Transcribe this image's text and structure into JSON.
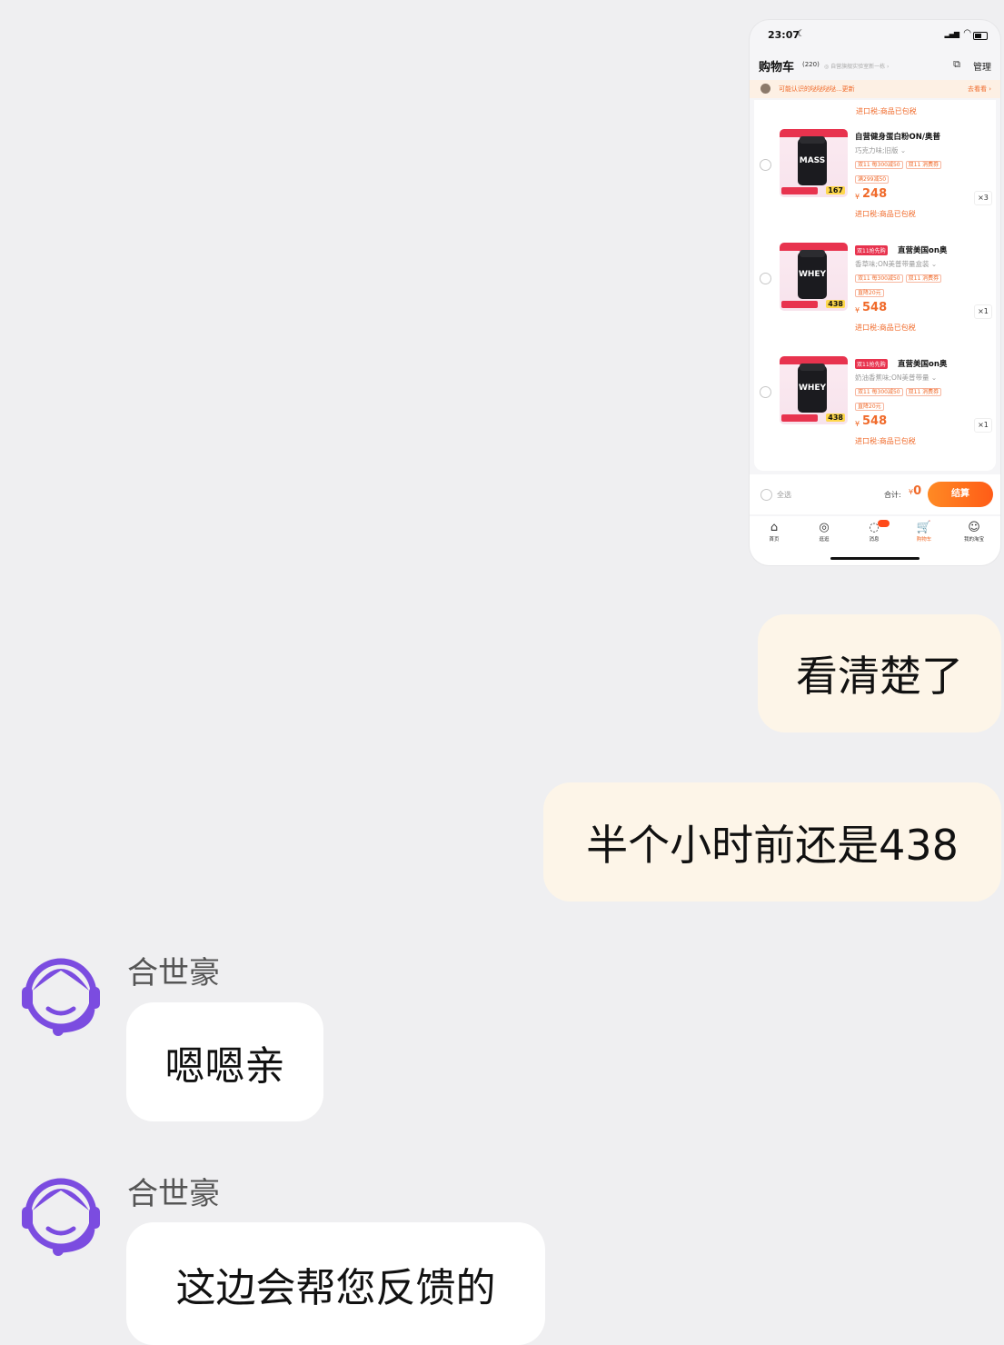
{
  "screenshot": {
    "status_bar": {
      "time": "23:07"
    },
    "header": {
      "title": "购物车",
      "count": "(220)",
      "address": "◎ 自营旗舰实验室新一栋 ›",
      "manage": "管理"
    },
    "notice": {
      "text": "可能认识的哒哒哒哒...更新",
      "action": "去看看 ›"
    },
    "top_tax": "进口税:商品已包税",
    "items": [
      {
        "tag": "",
        "name": "自营健身蛋白粉ON/奥普",
        "spec": "巧克力味;旧版 ⌄",
        "promos": [
          "双11 每300减50",
          "双11 消费券"
        ],
        "promo2": "满299减50",
        "image_label": "MASS",
        "image_price": "167",
        "price_symbol": "¥",
        "price": "248",
        "qty": "×3",
        "tax": "进口税:商品已包税"
      },
      {
        "tag": "双11抢先购",
        "name": "直营美国on奥",
        "spec": "香草味;ON美普带量盒装 ⌄",
        "promos": [
          "双11 每300减50",
          "双11 消费券"
        ],
        "promo2": "直降20元",
        "image_label": "WHEY",
        "image_price": "438",
        "price_symbol": "¥",
        "price": "548",
        "qty": "×1",
        "tax": "进口税:商品已包税"
      },
      {
        "tag": "双11抢先购",
        "name": "直营美国on奥",
        "spec": "奶油香蕉味;ON美普带量 ⌄",
        "promos": [
          "双11 每300减50",
          "双11 消费券"
        ],
        "promo2": "直降20元",
        "image_label": "WHEY",
        "image_price": "438",
        "price_symbol": "¥",
        "price": "548",
        "qty": "×1",
        "tax": "进口税:商品已包税"
      }
    ],
    "footer": {
      "select_all": "全选",
      "total_label": "合计:",
      "total_symbol": "¥",
      "total_value": "0",
      "checkout": "结算"
    },
    "tabs": [
      {
        "label": "首页",
        "icon": "home-icon",
        "glyph": "⌂"
      },
      {
        "label": "逛逛",
        "icon": "explore-icon",
        "glyph": "◎"
      },
      {
        "label": "消息",
        "icon": "message-icon",
        "glyph": "◌"
      },
      {
        "label": "购物车",
        "icon": "cart-icon",
        "glyph": "🛒"
      },
      {
        "label": "我的淘宝",
        "icon": "profile-icon",
        "glyph": "☺"
      }
    ]
  },
  "chat": {
    "messages": [
      {
        "side": "right",
        "text": "看清楚了"
      },
      {
        "side": "right",
        "text": "半个小时前还是438"
      },
      {
        "side": "left",
        "sender": "合世豪",
        "text": "嗯嗯亲"
      },
      {
        "side": "left",
        "sender": "合世豪",
        "text": "这边会帮您反馈的"
      }
    ]
  },
  "colors": {
    "background": "#efeff1",
    "self_bubble": "#fdf5e8",
    "agent_bubble": "#ffffff",
    "accent": "#f06a2a",
    "avatar": "#7b4ce0"
  }
}
